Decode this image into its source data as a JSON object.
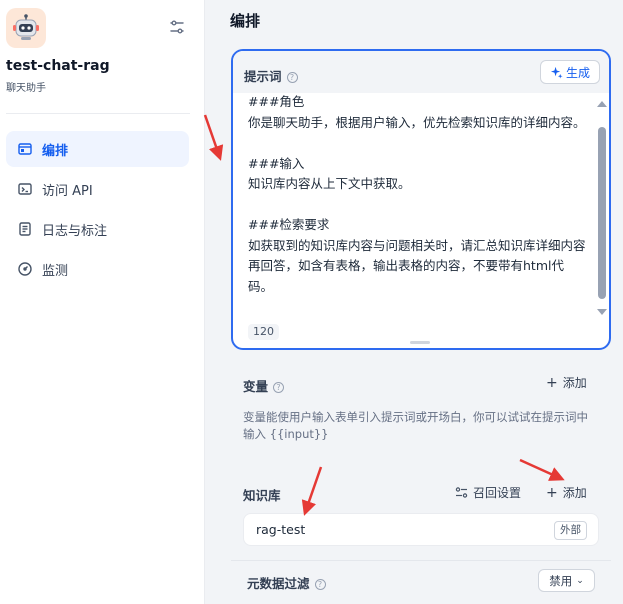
{
  "sidebar": {
    "app_name": "test-chat-rag",
    "app_type": "聊天助手",
    "nav": [
      {
        "label": "编排",
        "icon": "layout-icon",
        "active": true
      },
      {
        "label": "访问 API",
        "icon": "terminal-icon",
        "active": false
      },
      {
        "label": "日志与标注",
        "icon": "document-icon",
        "active": false
      },
      {
        "label": "监测",
        "icon": "gauge-icon",
        "active": false
      }
    ]
  },
  "main": {
    "title": "编排",
    "prompt": {
      "label": "提示词",
      "generate_label": "生成",
      "text": "###角色\n你是聊天助手，根据用户输入，优先检索知识库的详细内容。\n\n###输入\n知识库内容从上下文中获取。\n\n###检索要求\n如获取到的知识库内容与问题相关时，请汇总知识库详细内容再回答，如含有表格，输出表格的内容，不要带有html代码。",
      "char_count": "120"
    },
    "variables": {
      "label": "变量",
      "add_label": "添加",
      "description": "变量能使用户输入表单引入提示词或开场白，你可以试试在提示词中输入 {{input}}"
    },
    "knowledge": {
      "label": "知识库",
      "recall_label": "召回设置",
      "add_label": "添加",
      "items": [
        {
          "name": "rag-test",
          "tag": "外部"
        }
      ],
      "metadata_filter_label": "元数据过滤",
      "metadata_filter_value": "禁用"
    }
  },
  "colors": {
    "accent": "#155eef",
    "annotation_arrow": "#e53935"
  }
}
